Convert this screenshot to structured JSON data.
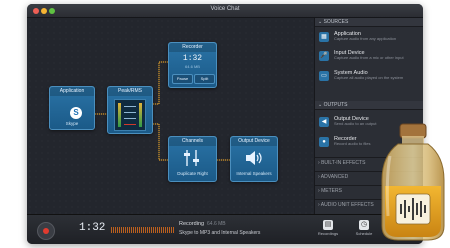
{
  "window": {
    "title": "Voice Chat"
  },
  "nodes": {
    "application": {
      "title": "Application",
      "label": "Skype"
    },
    "peak_rms": {
      "title": "Peak/RMS"
    },
    "recorder": {
      "title": "Recorder",
      "time": "1:32",
      "sub": "64.6 MB",
      "btn_pause": "Pause",
      "btn_split": "Split"
    },
    "channels": {
      "title": "Channels",
      "label": "Duplicate Right"
    },
    "output_device": {
      "title": "Output Device",
      "label": "Internal Speakers"
    }
  },
  "sidebar": {
    "sources_header": "SOURCES",
    "sources": [
      {
        "title": "Application",
        "desc": "Capture audio from any application",
        "icon": "application-icon"
      },
      {
        "title": "Input Device",
        "desc": "Capture audio from a mic or other input",
        "icon": "microphone-icon"
      },
      {
        "title": "System Audio",
        "desc": "Capture all audio played on the system",
        "icon": "monitor-icon"
      }
    ],
    "outputs_header": "OUTPUTS",
    "outputs": [
      {
        "title": "Output Device",
        "desc": "Send audio to an output",
        "icon": "speaker-icon"
      },
      {
        "title": "Recorder",
        "desc": "Record audio to files",
        "icon": "recorder-icon"
      }
    ],
    "collapsed": [
      "BUILT-IN EFFECTS",
      "ADVANCED",
      "METERS",
      "AUDIO UNIT EFFECTS"
    ]
  },
  "bottom": {
    "timer": "1:32",
    "status": "Recording",
    "size": "64.6 MB",
    "desc": "Skype to MP3 and Internal Speakers",
    "recordings_label": "Recordings",
    "schedule_label": "Schedule"
  },
  "colors": {
    "accent": "#2a73a6",
    "record": "#e23b2f",
    "connection": "#d99a2b"
  }
}
